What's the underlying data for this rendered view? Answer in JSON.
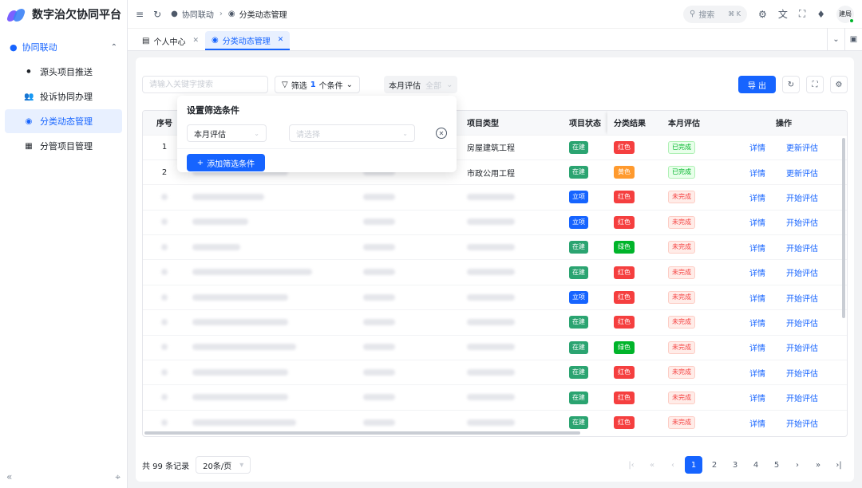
{
  "app": {
    "title": "数字治欠协同平台"
  },
  "sidebar": {
    "group_label": "协同联动",
    "items": [
      {
        "label": "源头项目推送",
        "icon": "plus-circle-icon"
      },
      {
        "label": "投诉协同办理",
        "icon": "users-icon"
      },
      {
        "label": "分类动态管理",
        "icon": "category-icon",
        "active": true
      },
      {
        "label": "分管项目管理",
        "icon": "board-icon"
      }
    ]
  },
  "header": {
    "breadcrumb": [
      "协同联动",
      "分类动态管理"
    ],
    "search_label": "搜索",
    "search_shortcut": "⌘ K",
    "user": "建局"
  },
  "tabs": [
    {
      "label": "个人中心",
      "active": false
    },
    {
      "label": "分类动态管理",
      "active": true
    }
  ],
  "toolbar": {
    "keyword_placeholder": "请输入关键字搜索",
    "filter_label": "筛选",
    "filter_count": "1",
    "filter_unit": "个条件",
    "month_tag_label": "本月评估",
    "month_tag_value": "全部",
    "export_label": "导 出"
  },
  "popover": {
    "title": "设置筛选条件",
    "field_value": "本月评估",
    "value_placeholder": "请选择",
    "add_label": "添加筛选条件"
  },
  "table": {
    "headers": {
      "idx": "序号",
      "type": "项目类型",
      "status": "项目状态",
      "cls": "分类结果",
      "eval": "本月评估",
      "ops": "操作"
    },
    "ops": {
      "detail": "详情",
      "update": "更新评估",
      "start": "开始评估"
    },
    "rows": [
      {
        "idx": "1",
        "type": "房屋建筑工程",
        "status": "在建",
        "cls": "红色",
        "eval": "已完成"
      },
      {
        "idx": "2",
        "type": "市政公用工程",
        "status": "在建",
        "cls": "黄色",
        "eval": "已完成"
      },
      {
        "status": "立项",
        "cls": "红色",
        "eval": "未完成"
      },
      {
        "status": "立项",
        "cls": "红色",
        "eval": "未完成"
      },
      {
        "status": "在建",
        "cls": "绿色",
        "eval": "未完成"
      },
      {
        "status": "在建",
        "cls": "红色",
        "eval": "未完成"
      },
      {
        "status": "立项",
        "cls": "红色",
        "eval": "未完成"
      },
      {
        "status": "在建",
        "cls": "红色",
        "eval": "未完成"
      },
      {
        "status": "在建",
        "cls": "绿色",
        "eval": "未完成"
      },
      {
        "status": "在建",
        "cls": "红色",
        "eval": "未完成"
      },
      {
        "status": "在建",
        "cls": "红色",
        "eval": "未完成"
      },
      {
        "status": "在建",
        "cls": "红色",
        "eval": "未完成"
      }
    ]
  },
  "footer": {
    "total": "共 99 条记录",
    "page_size": "20条/页",
    "pages": [
      "1",
      "2",
      "3",
      "4",
      "5"
    ],
    "current_page": "1"
  },
  "colors": {
    "primary": "#1664ff",
    "red": "#f53f3f",
    "yellow": "#ff9a2e",
    "green": "#00b42a",
    "status_active": "#2ba471"
  }
}
